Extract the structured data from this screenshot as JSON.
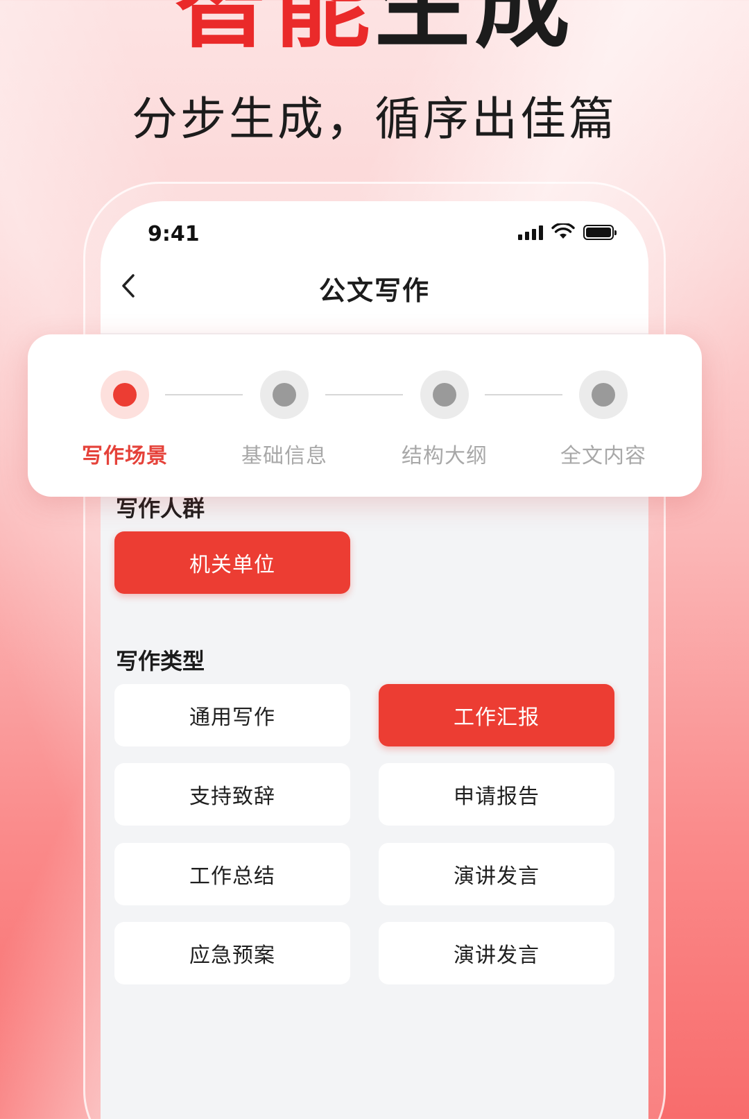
{
  "hero": {
    "title_accent": "智能",
    "title_rest": "生成",
    "subtitle": "分步生成，循序出佳篇"
  },
  "status_bar": {
    "time": "9:41"
  },
  "nav": {
    "title": "公文写作"
  },
  "steps": [
    {
      "label": "写作场景",
      "active": true
    },
    {
      "label": "基础信息",
      "active": false
    },
    {
      "label": "结构大纲",
      "active": false
    },
    {
      "label": "全文内容",
      "active": false
    }
  ],
  "audience": {
    "label": "写作人群",
    "options": [
      {
        "label": "机关单位",
        "selected": true
      }
    ]
  },
  "types": {
    "label": "写作类型",
    "options": [
      {
        "label": "通用写作",
        "selected": false
      },
      {
        "label": "工作汇报",
        "selected": true
      },
      {
        "label": "支持致辞",
        "selected": false
      },
      {
        "label": "申请报告",
        "selected": false
      },
      {
        "label": "工作总结",
        "selected": false
      },
      {
        "label": "演讲发言",
        "selected": false
      },
      {
        "label": "应急预案",
        "selected": false
      },
      {
        "label": "演讲发言",
        "selected": false
      }
    ]
  },
  "colors": {
    "accent": "#ec3d33",
    "background_top": "#fde3e3",
    "background_bottom": "#f86c6c"
  }
}
